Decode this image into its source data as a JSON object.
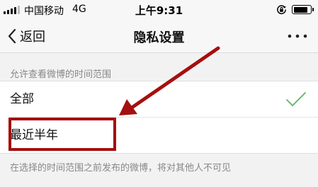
{
  "status_bar": {
    "carrier": "中国移动",
    "network": "4G",
    "time": "上午9:31",
    "signal_bars_filled": 4,
    "battery_level": 0.9
  },
  "nav": {
    "back_label": "返回",
    "title": "隐私设置",
    "more_icon": "more-dots-icon"
  },
  "section": {
    "label": "允许查看微博的时间范围"
  },
  "options": [
    {
      "label": "全部",
      "selected": true
    },
    {
      "label": "最近半年",
      "selected": false,
      "highlighted": true
    }
  ],
  "footer_note": "在选择的时间范围之前发布的微博，将对其他人不可见",
  "colors": {
    "check": "#5cb85c",
    "annotation": "#a50f0f",
    "background": "#f2f2f2"
  }
}
